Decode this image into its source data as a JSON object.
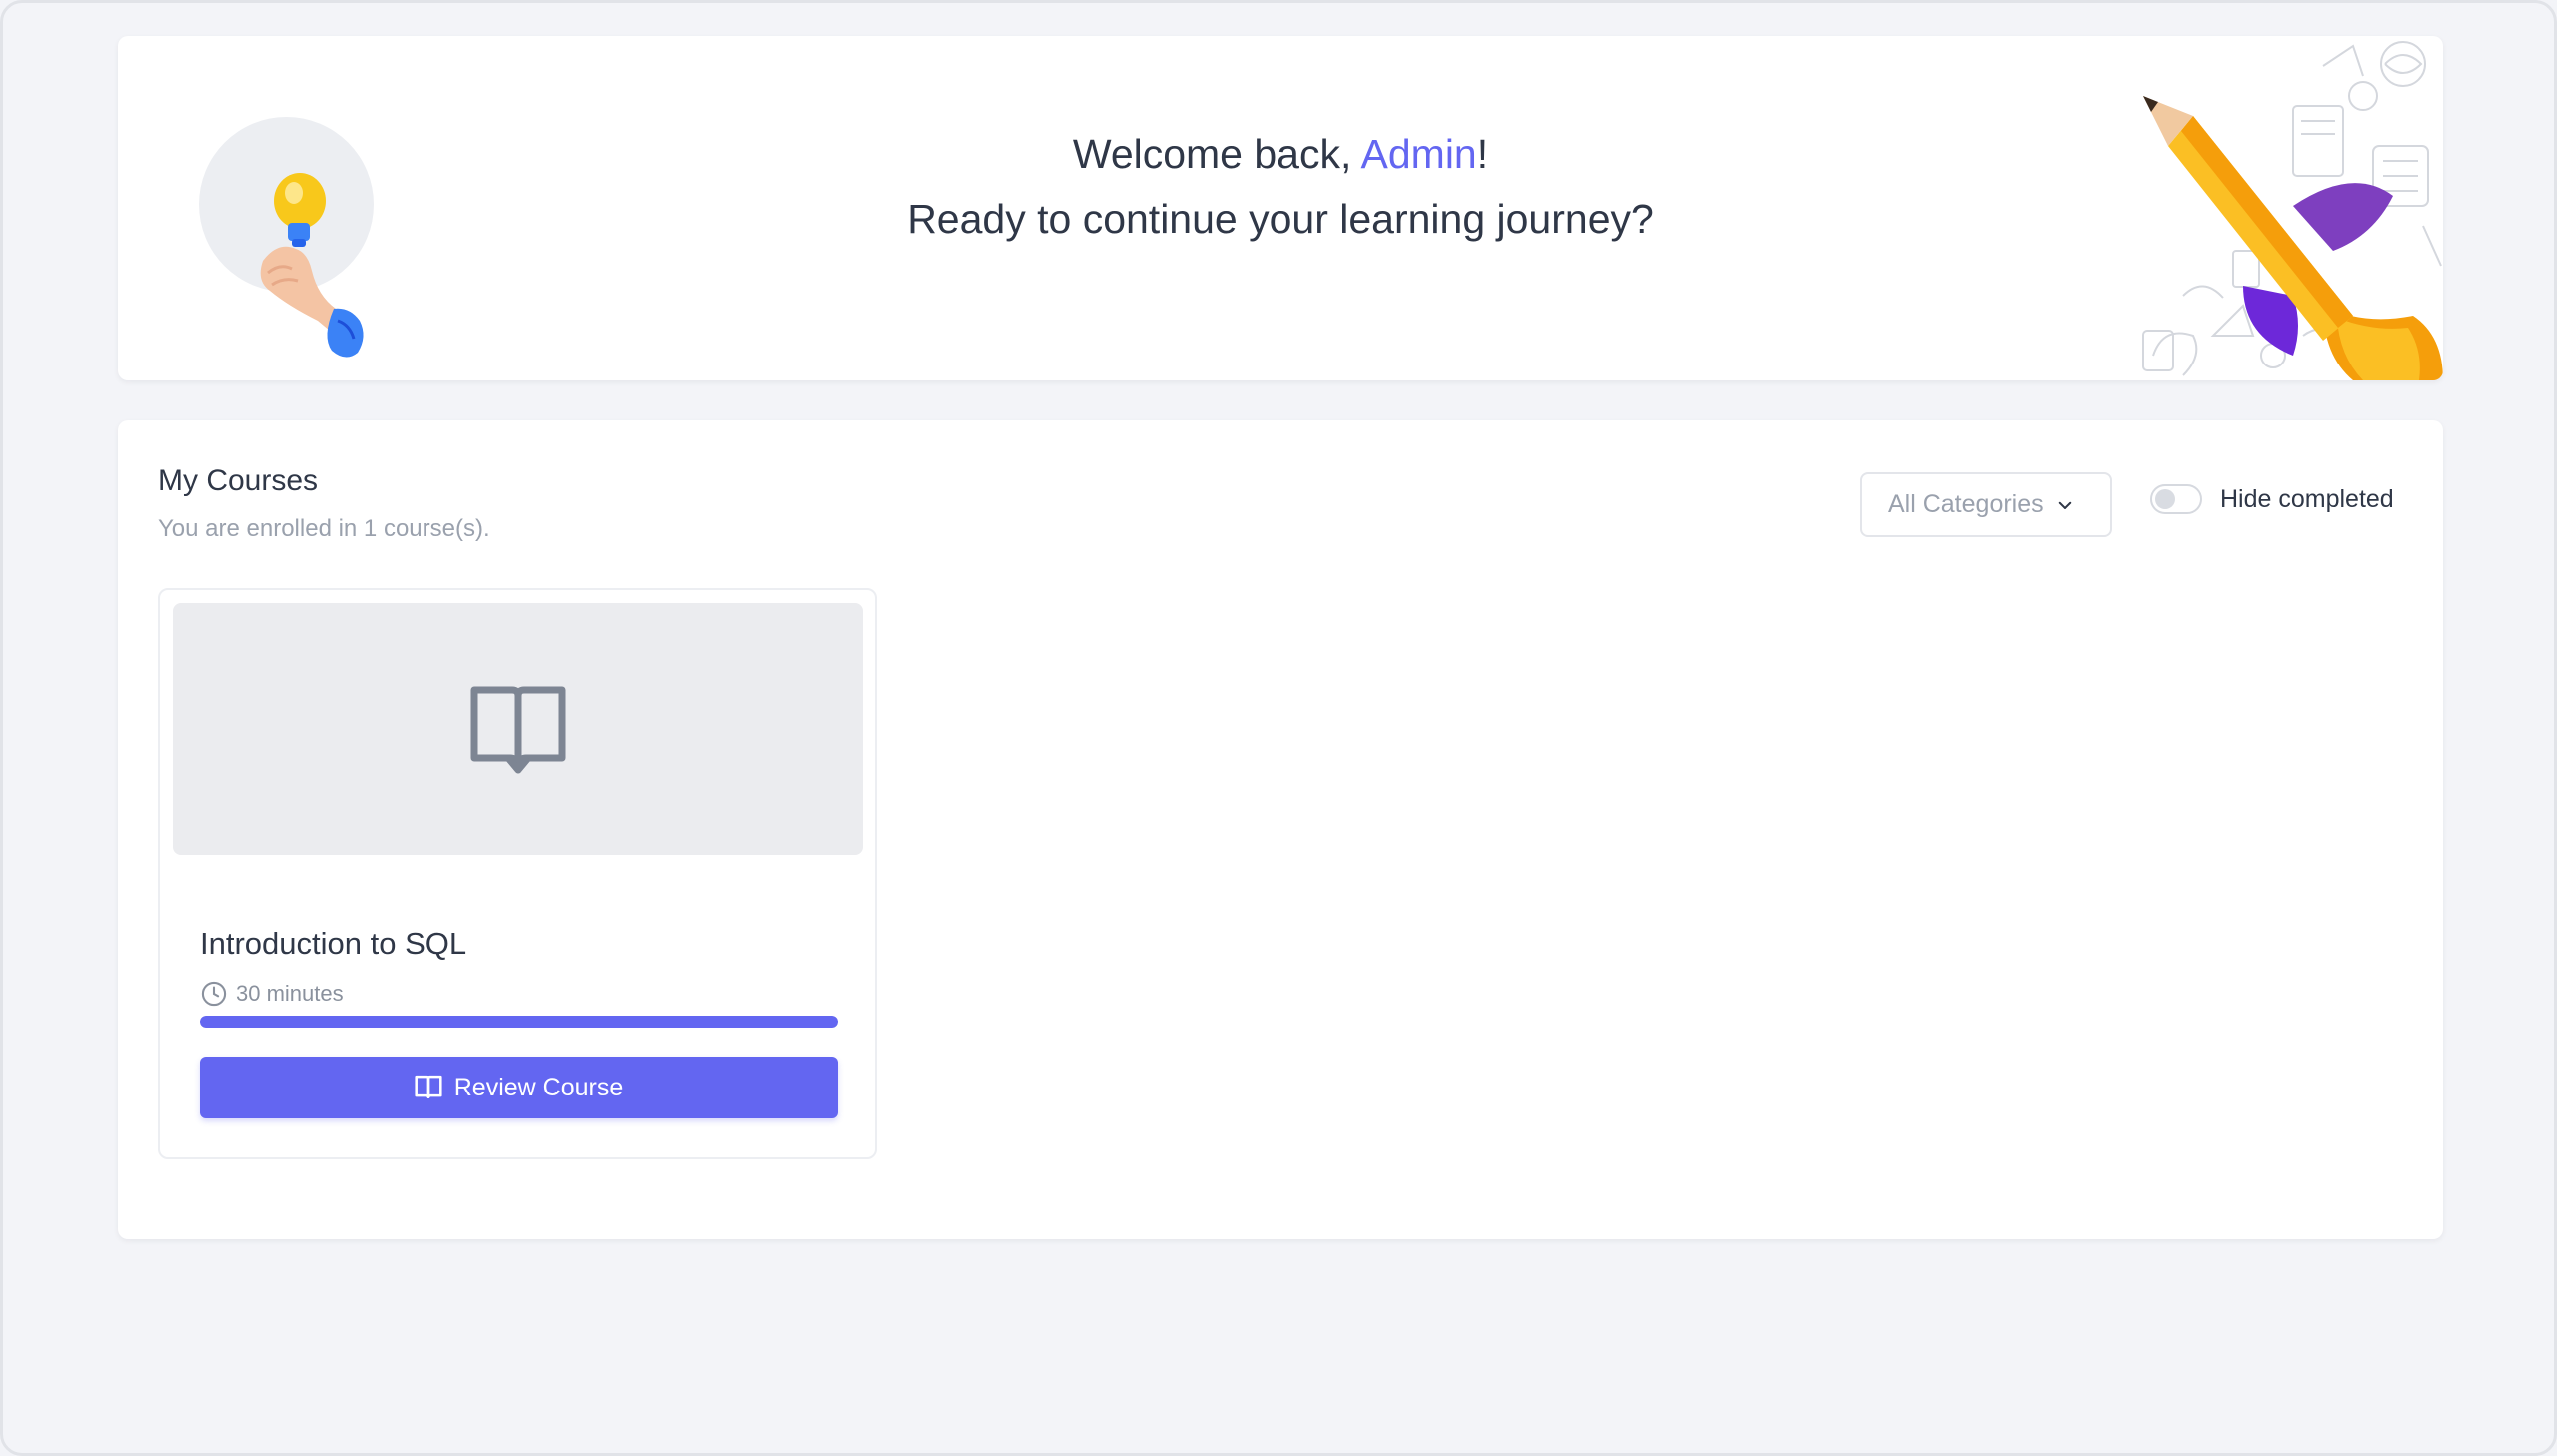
{
  "welcome": {
    "greeting_prefix": "Welcome back, ",
    "user_name": "Admin",
    "greeting_suffix": "!",
    "subtitle": "Ready to continue your learning journey?"
  },
  "courses_section": {
    "title": "My Courses",
    "enrolled_text": "You are enrolled in 1 course(s).",
    "category_filter": {
      "selected": "All Categories"
    },
    "hide_completed": {
      "label": "Hide completed",
      "on": false
    },
    "items": [
      {
        "title": "Introduction to SQL",
        "duration": "30 minutes",
        "progress": 1.0,
        "action_label": "Review Course",
        "thumbnail_icon": "book-open-icon"
      }
    ]
  },
  "colors": {
    "accent": "#6366f1",
    "background": "#f3f4f8",
    "text": "#2f3747",
    "muted": "#9aa1ad"
  }
}
